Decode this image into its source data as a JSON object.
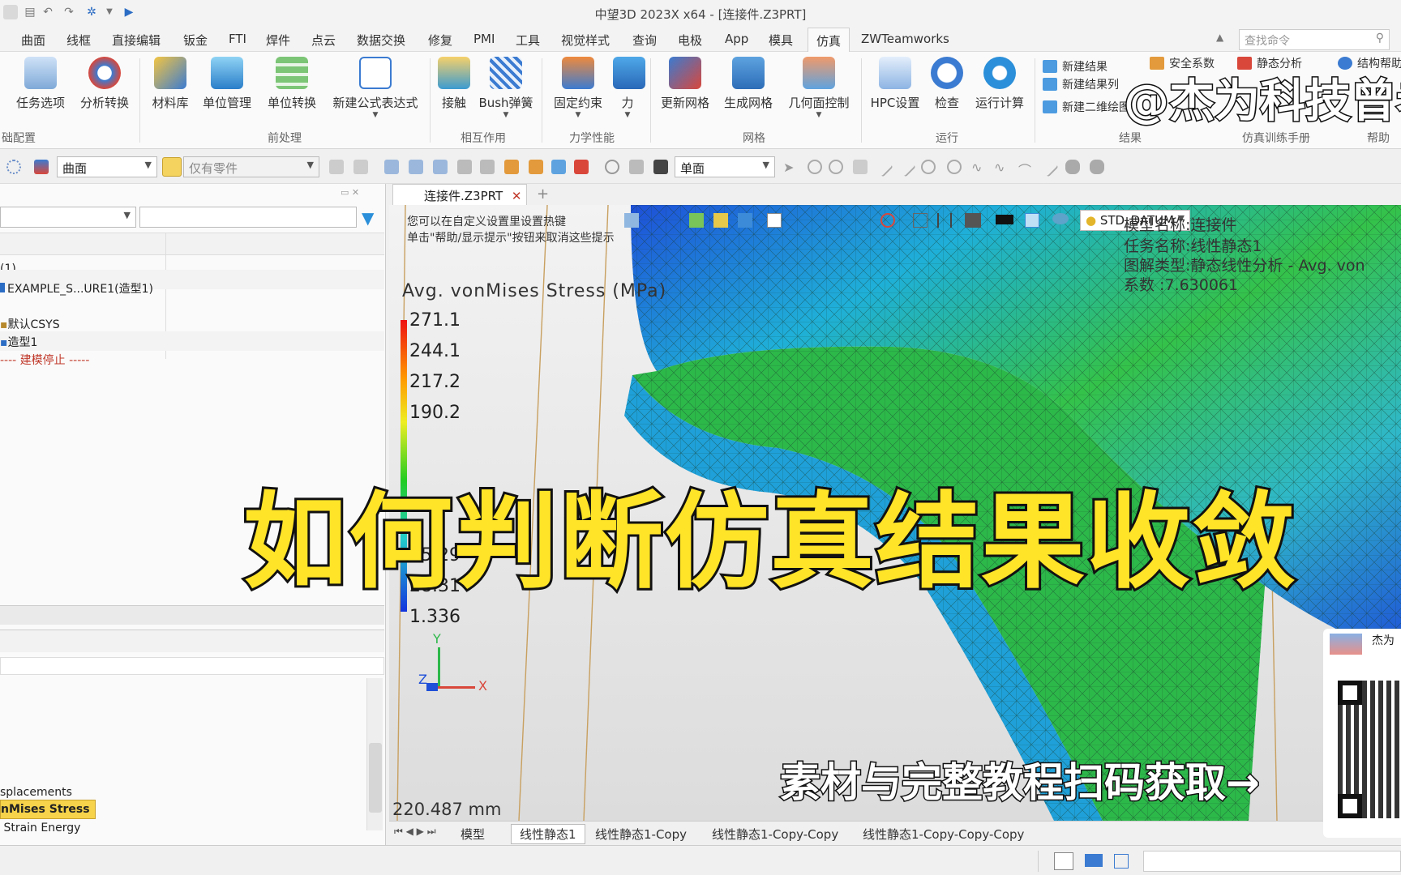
{
  "window": {
    "title": "中望3D 2023X x64 - [连接件.Z3PRT]"
  },
  "menu": [
    {
      "label": "曲面"
    },
    {
      "label": "线框"
    },
    {
      "label": "直接编辑"
    },
    {
      "label": "钣金"
    },
    {
      "label": "FTI"
    },
    {
      "label": "焊件"
    },
    {
      "label": "点云"
    },
    {
      "label": "数据交换"
    },
    {
      "label": "修复"
    },
    {
      "label": "PMI"
    },
    {
      "label": "工具"
    },
    {
      "label": "视觉样式"
    },
    {
      "label": "查询"
    },
    {
      "label": "电极"
    },
    {
      "label": "App"
    },
    {
      "label": "模具"
    },
    {
      "label": "仿真"
    },
    {
      "label": "ZWTeamworks"
    }
  ],
  "search": {
    "placeholder": "查找命令"
  },
  "ribbon": {
    "buttons": [
      {
        "label": "任务选项",
        "icon": "task-options-icon"
      },
      {
        "label": "分析转换",
        "icon": "analysis-convert-icon"
      },
      {
        "label": "材料库",
        "icon": "material-library-icon"
      },
      {
        "label": "单位管理",
        "icon": "unit-manage-icon"
      },
      {
        "label": "单位转换",
        "icon": "unit-convert-icon"
      },
      {
        "label": "新建公式表达式",
        "icon": "formula-icon"
      },
      {
        "label": "接触",
        "icon": "contact-icon"
      },
      {
        "label": "Bush弹簧",
        "icon": "bush-spring-icon"
      },
      {
        "label": "固定约束",
        "icon": "fixed-constraint-icon"
      },
      {
        "label": "力",
        "icon": "force-icon"
      },
      {
        "label": "更新网格",
        "icon": "update-mesh-icon"
      },
      {
        "label": "生成网格",
        "icon": "generate-mesh-icon"
      },
      {
        "label": "几何面控制",
        "icon": "face-control-icon"
      },
      {
        "label": "HPC设置",
        "icon": "hpc-icon"
      },
      {
        "label": "检查",
        "icon": "check-icon"
      },
      {
        "label": "运行计算",
        "icon": "run-icon"
      }
    ],
    "small_buttons": [
      {
        "label": "新建结果"
      },
      {
        "label": "新建结果列"
      },
      {
        "label": "新建二维绘图"
      },
      {
        "label": "安全系数"
      },
      {
        "label": "静态分析"
      },
      {
        "label": "结构帮助"
      }
    ],
    "groups": [
      {
        "label": "础配置"
      },
      {
        "label": "前处理"
      },
      {
        "label": "相互作用"
      },
      {
        "label": "力学性能"
      },
      {
        "label": "网格"
      },
      {
        "label": "运行"
      },
      {
        "label": "结果"
      },
      {
        "label": "仿真训练手册"
      },
      {
        "label": "帮助"
      }
    ]
  },
  "toolbar2": {
    "filter_value": "曲面",
    "scope_value": "仅有零件",
    "view_value": "单面"
  },
  "tree": {
    "rows": [
      {
        "text": "(1)"
      },
      {
        "text": "EXAMPLE_S...URE1(造型1)"
      },
      {
        "text": "默认CSYS"
      },
      {
        "text": "造型1"
      },
      {
        "text": "---- 建模停止 -----"
      }
    ],
    "results": [
      {
        "text": "splacements"
      },
      {
        "text": "nMises Stress"
      },
      {
        "text": "Strain Energy"
      }
    ]
  },
  "doc_tab": {
    "label": "连接件.Z3PRT"
  },
  "viewport": {
    "hint1": "您可以在自定义设置里设置热键",
    "hint2": "单击\"帮助/显示提示\"按钮来取消这些提示",
    "legend_title": "Avg. vonMises Stress (MPa)",
    "legend_values": [
      "271.1",
      "244.1",
      "217.2",
      "190.2",
      "55.29",
      "28.31",
      "1.336"
    ],
    "info_lines": [
      "模型名称:连接件",
      "任务名称:线性静态1",
      "图解类型:静态线性分析 - Avg. von",
      "系数 :7.630061"
    ],
    "datum_label": "STD_DATUM",
    "scale_label": "220.487 mm",
    "axis_x": "X",
    "axis_y": "Y",
    "axis_z": "Z"
  },
  "bottom_tabs": [
    {
      "label": "模型"
    },
    {
      "label": "线性静态1"
    },
    {
      "label": "线性静态1-Copy"
    },
    {
      "label": "线性静态1-Copy-Copy"
    },
    {
      "label": "线性静态1-Copy-Copy-Copy"
    }
  ],
  "overlay": {
    "title": "如何判断仿真结果收敛",
    "watermark": "@杰为科技曾老",
    "cta": "素材与完整教程扫码获取→",
    "qr_caption": "杰为"
  },
  "colors": {
    "accent": "#2b6cc4",
    "overlay_yellow": "#ffe428",
    "legend_top": "#e11",
    "legend_bottom": "#1133dd"
  }
}
